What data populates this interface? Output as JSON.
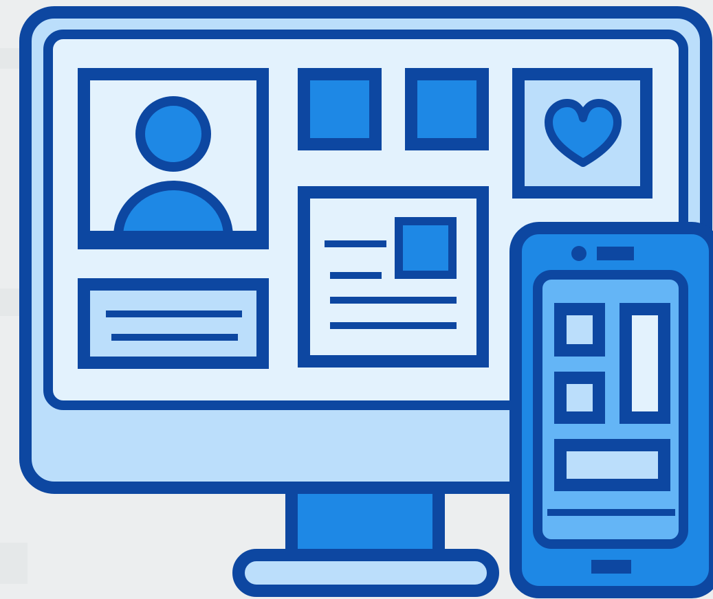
{
  "illustration": {
    "subject": "responsive-design-devices-icon",
    "devices": [
      "desktop-monitor",
      "smartphone"
    ],
    "monitor_widgets": [
      "user-profile-card",
      "tile",
      "tile",
      "favorite-heart-card",
      "text-card",
      "article-card"
    ],
    "phone_widgets": [
      "small-tile",
      "small-tile",
      "tall-panel",
      "wide-panel",
      "divider-line"
    ]
  },
  "colors": {
    "background": "#eceeef",
    "outline": "#0d47a1",
    "accent": "#1e88e5",
    "light_fill": "#bbdefb",
    "screen_fill": "#e3f2fd",
    "phone_screen": "#64b5f6",
    "white_panel": "#e3f2fd"
  },
  "icons": {
    "user": "user-avatar-icon",
    "heart": "heart-icon",
    "camera": "phone-camera-icon",
    "speaker": "phone-speaker-icon",
    "home_button": "phone-home-button-icon"
  }
}
